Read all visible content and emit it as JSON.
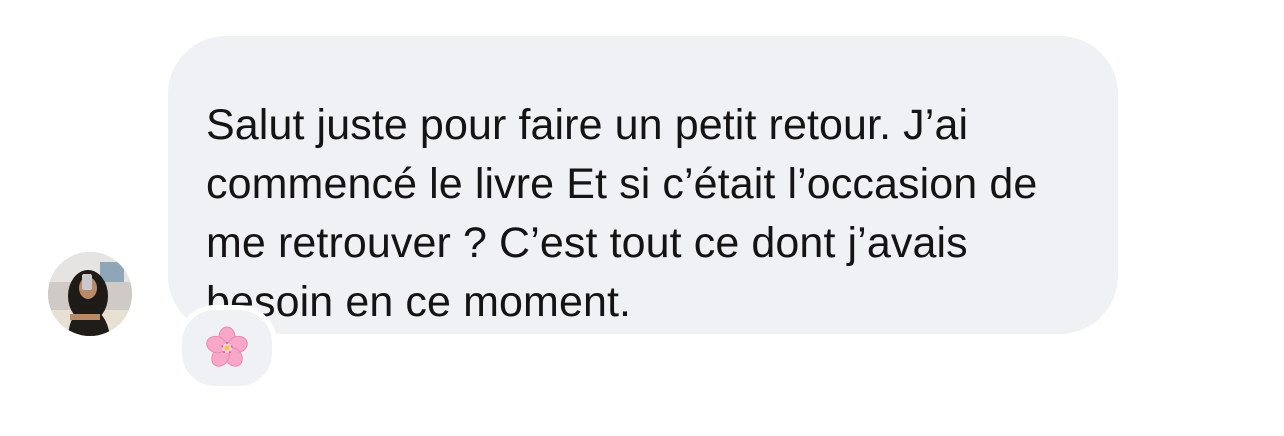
{
  "message": {
    "text": "Salut juste pour faire un petit retour. J’ai commencé le livre Et si c’était l’occasion de me retrouver ? C’est tout ce dont j’avais besoin en ce moment."
  },
  "reaction": {
    "emoji_name": "cherry-blossom-icon",
    "color": "#f6a6c8"
  },
  "colors": {
    "bubble": "#f0f1f5",
    "text": "#141414",
    "background": "#ffffff"
  }
}
